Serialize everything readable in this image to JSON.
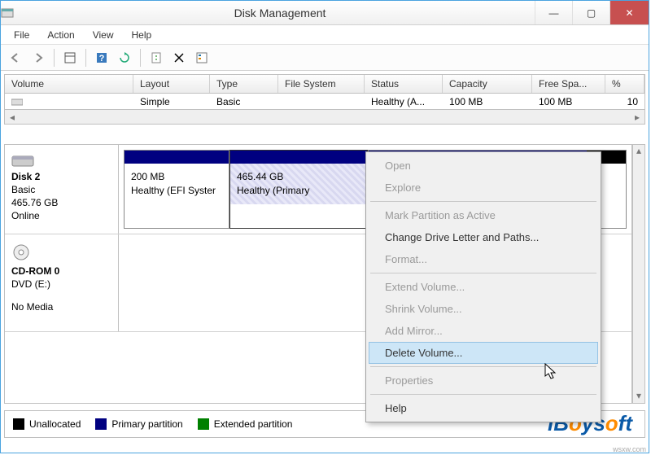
{
  "window": {
    "title": "Disk Management",
    "buttons": {
      "min": "—",
      "max": "▢",
      "close": "✕"
    }
  },
  "menubar": [
    "File",
    "Action",
    "View",
    "Help"
  ],
  "columns": {
    "volume": "Volume",
    "layout": "Layout",
    "type": "Type",
    "filesystem": "File System",
    "status": "Status",
    "capacity": "Capacity",
    "freespace": "Free Spa...",
    "pct": "%"
  },
  "row0": {
    "volume": "",
    "layout": "Simple",
    "type": "Basic",
    "filesystem": "",
    "status": "Healthy (A...",
    "capacity": "100 MB",
    "freespace": "100 MB",
    "pct": "10"
  },
  "disk2": {
    "name": "Disk 2",
    "type": "Basic",
    "size": "465.76 GB",
    "state": "Online",
    "part1": {
      "size": "200 MB",
      "status": "Healthy (EFI Syster"
    },
    "part2": {
      "size": "465.44 GB",
      "status": "Healthy (Primary"
    }
  },
  "cdrom": {
    "name": "CD-ROM 0",
    "drive": "DVD (E:)",
    "state": "No Media"
  },
  "legend": {
    "unallocated": "Unallocated",
    "primary": "Primary partition",
    "extended": "Extended partition"
  },
  "context": {
    "open": "Open",
    "explore": "Explore",
    "mark": "Mark Partition as Active",
    "drive": "Change Drive Letter and Paths...",
    "format": "Format...",
    "extend": "Extend Volume...",
    "shrink": "Shrink Volume...",
    "mirror": "Add Mirror...",
    "delete": "Delete Volume...",
    "props": "Properties",
    "help": "Help"
  },
  "watermark": "iBoysoft",
  "wsxw": "wsxw.com"
}
